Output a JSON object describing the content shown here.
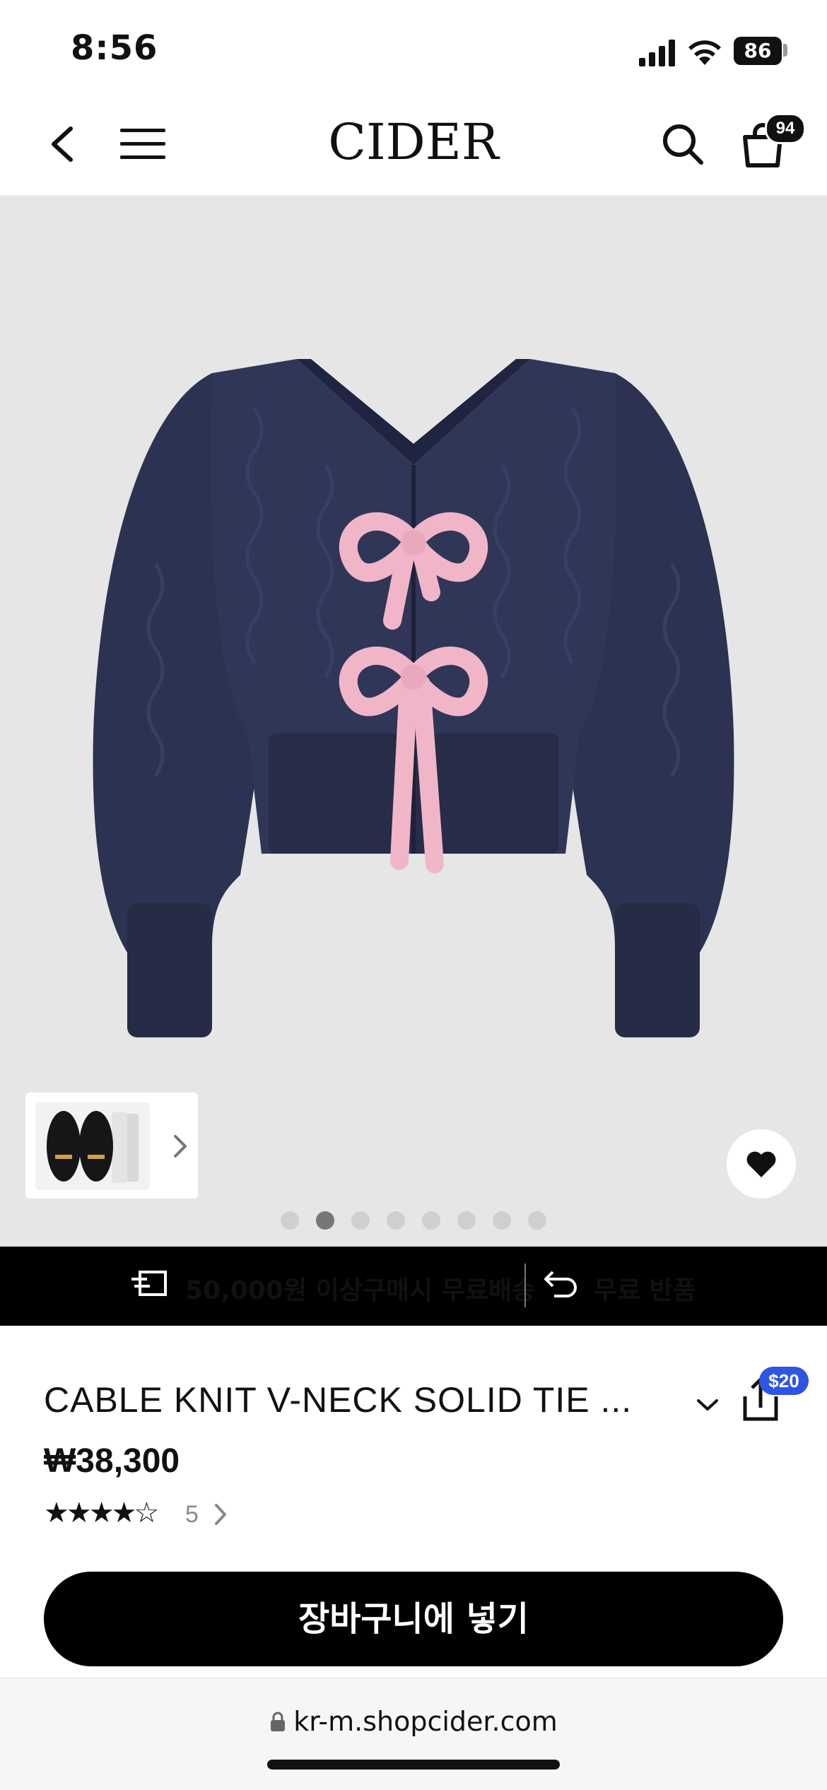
{
  "status_bar": {
    "time": "8:56",
    "battery": "86"
  },
  "header": {
    "logo": "CIDER",
    "cart_count": "94"
  },
  "gallery": {
    "slide_count": 8,
    "active_slide": 2
  },
  "promo": {
    "free_shipping": "50,000원 이상구매시 무료배송",
    "free_returns": "무료 반품"
  },
  "product": {
    "title": "CABLE KNIT V-NECK SOLID TIE ...",
    "price": "₩38,300",
    "rating": 4,
    "stars": "★★★★☆",
    "review_count": "5",
    "share_reward": "$20"
  },
  "cta": {
    "add_to_cart": "장바구니에 넣기"
  },
  "browser": {
    "url": "kr-m.shopcider.com"
  },
  "colors": {
    "sweater": "#2d3352",
    "ribbon": "#f0b6c8",
    "share_badge": "#2f55e4"
  }
}
